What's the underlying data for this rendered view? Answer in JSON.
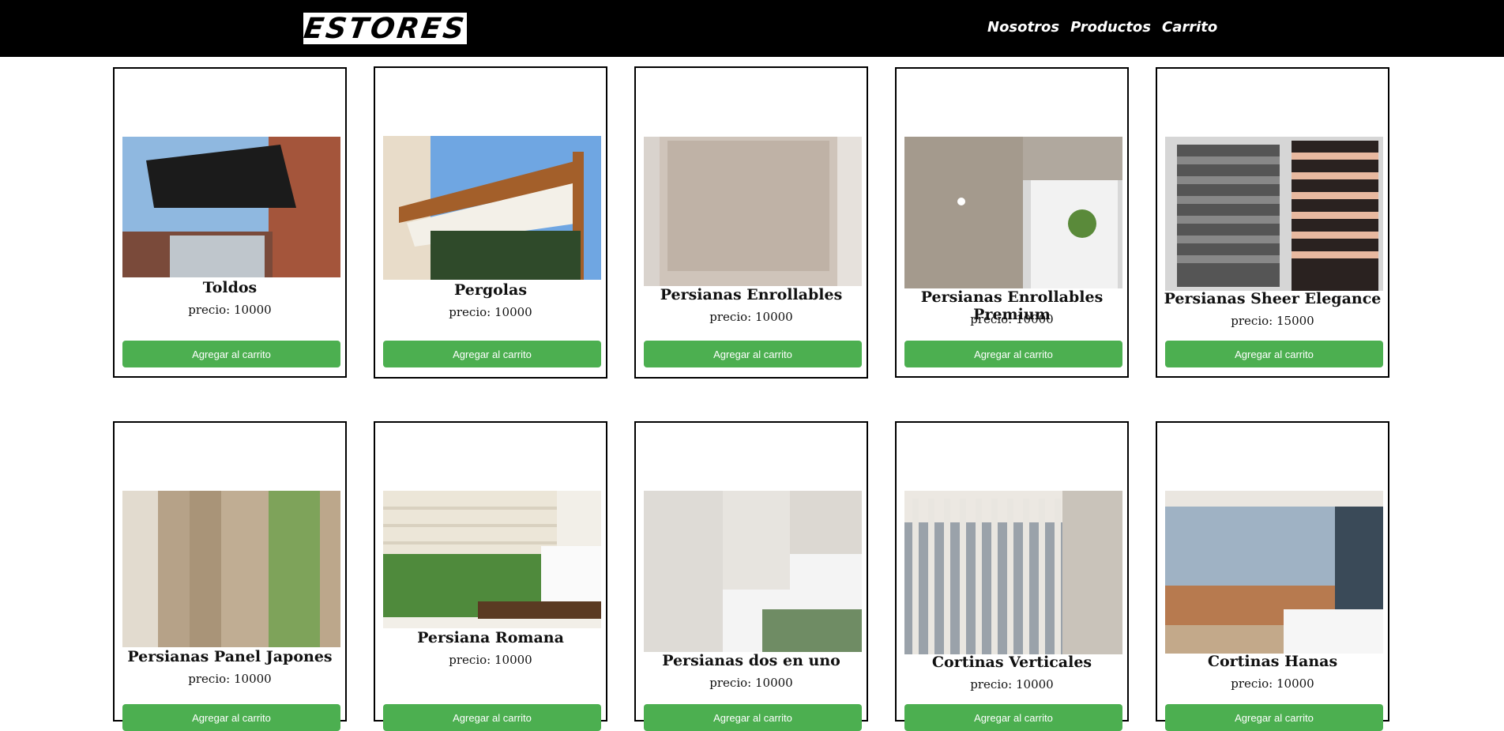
{
  "header": {
    "logo_text": "ESTORES",
    "nav": [
      "Nosotros",
      "Productos",
      "Carrito"
    ]
  },
  "products": [
    {
      "name": "Toldos",
      "price": "precio: 10000",
      "button": "Agregar al carrito",
      "image": "awning-photo"
    },
    {
      "name": "Pergolas",
      "price": "precio: 10000",
      "button": "Agregar al carrito",
      "image": "pergola-photo"
    },
    {
      "name": "Persianas Enrollables",
      "price": "precio: 10000",
      "button": "Agregar al carrito",
      "image": "roller-blind-photo"
    },
    {
      "name": "Persianas Enrollables Premium",
      "price": "precio: 10000",
      "button": "Agregar al carrito",
      "image": "premium-roller-photo"
    },
    {
      "name": "Persianas Sheer Elegance",
      "price": "precio: 15000",
      "button": "Agregar al carrito",
      "image": "sheer-elegance-photo"
    },
    {
      "name": "Persianas Panel Japones",
      "price": "precio: 10000",
      "button": "Agregar al carrito",
      "image": "japanese-panel-photo"
    },
    {
      "name": "Persiana Romana",
      "price": "precio: 10000",
      "button": "Agregar al carrito",
      "image": "roman-blind-photo"
    },
    {
      "name": "Persianas dos en uno",
      "price": "precio: 10000",
      "button": "Agregar al carrito",
      "image": "two-in-one-photo"
    },
    {
      "name": "Cortinas Verticales",
      "price": "precio: 10000",
      "button": "Agregar al carrito",
      "image": "vertical-curtain-photo"
    },
    {
      "name": "Cortinas Hanas",
      "price": "precio: 10000",
      "button": "Agregar al carrito",
      "image": "hanas-curtain-photo"
    }
  ],
  "colors": {
    "header_bg": "#000000",
    "button_bg": "#4caf50",
    "button_text": "#ffffff"
  }
}
